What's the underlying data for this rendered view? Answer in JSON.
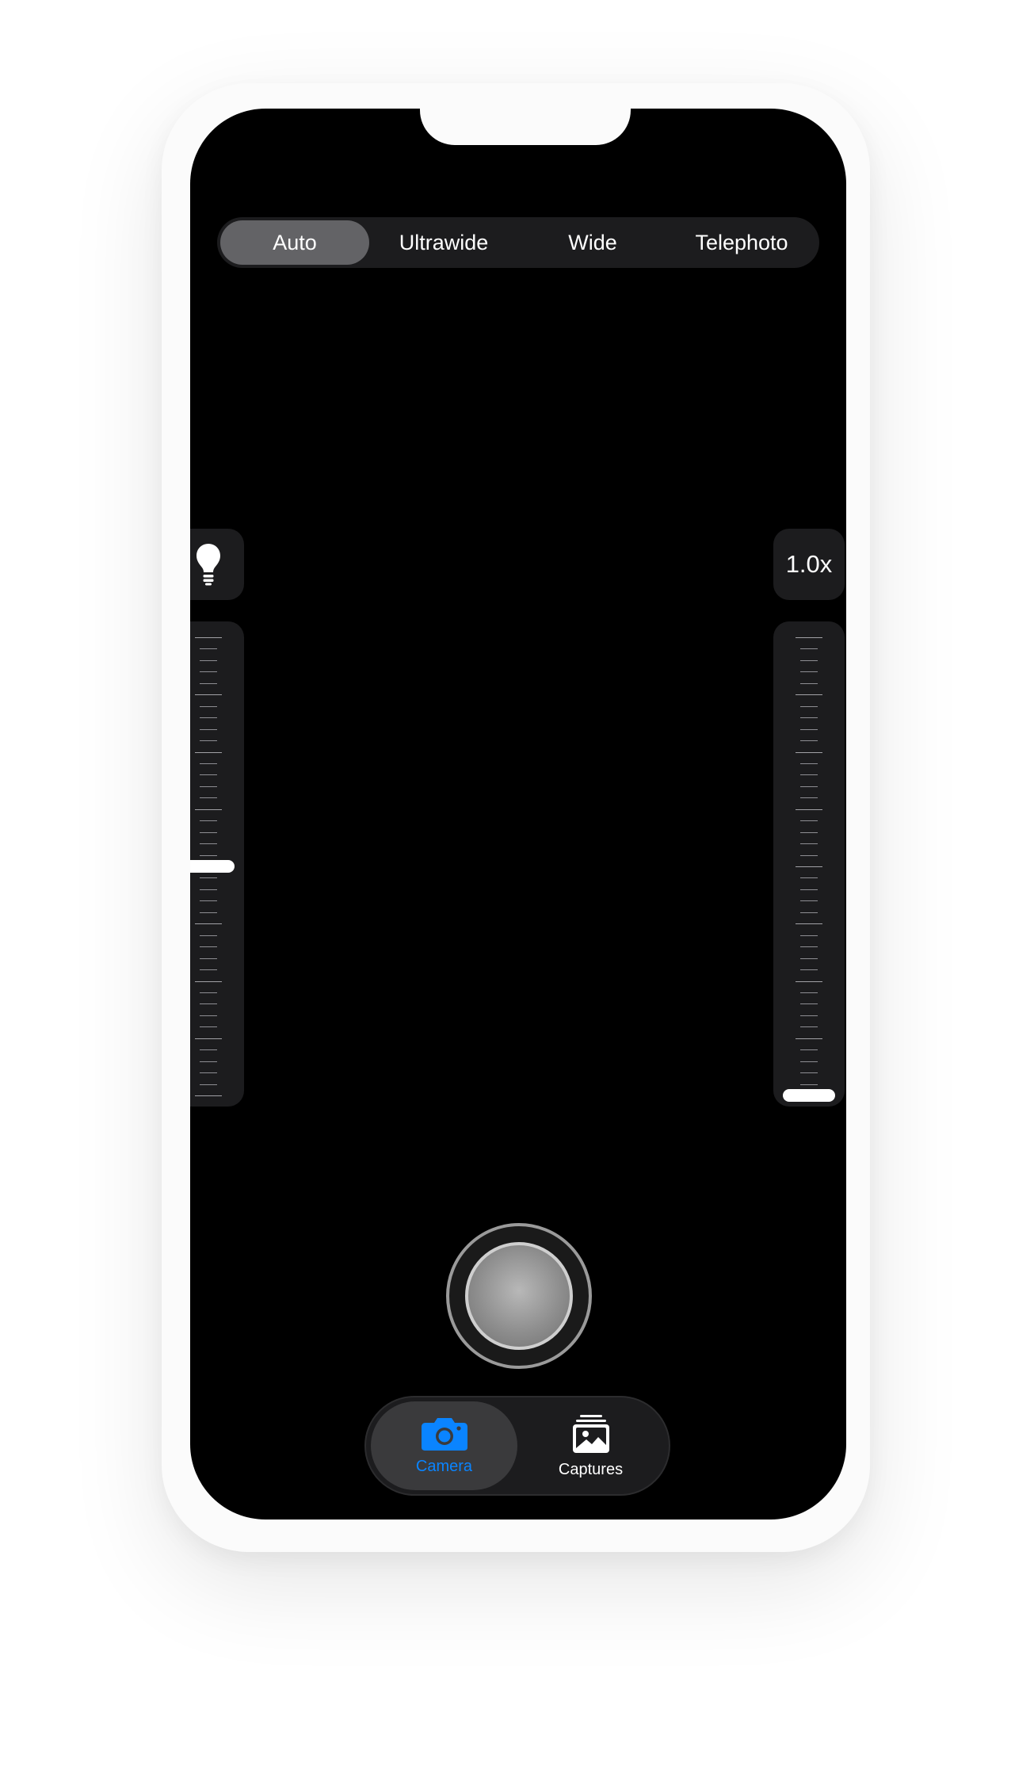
{
  "camera": {
    "lens_options": [
      {
        "label": "Auto",
        "selected": true
      },
      {
        "label": "Ultrawide",
        "selected": false
      },
      {
        "label": "Wide",
        "selected": false
      },
      {
        "label": "Telephoto",
        "selected": false
      }
    ],
    "torch_icon": "lightbulb-icon",
    "zoom_label": "1.0x",
    "torch_level": 0.5,
    "zoom_level": 0.0
  },
  "tabbar": {
    "items": [
      {
        "label": "Camera",
        "icon": "camera-icon",
        "selected": true
      },
      {
        "label": "Captures",
        "icon": "photo-stack-icon",
        "selected": false
      }
    ]
  },
  "colors": {
    "accent": "#0a84ff",
    "screen": "#000000",
    "control_bg": "#1c1c1e",
    "selected_segment": "#636366"
  }
}
